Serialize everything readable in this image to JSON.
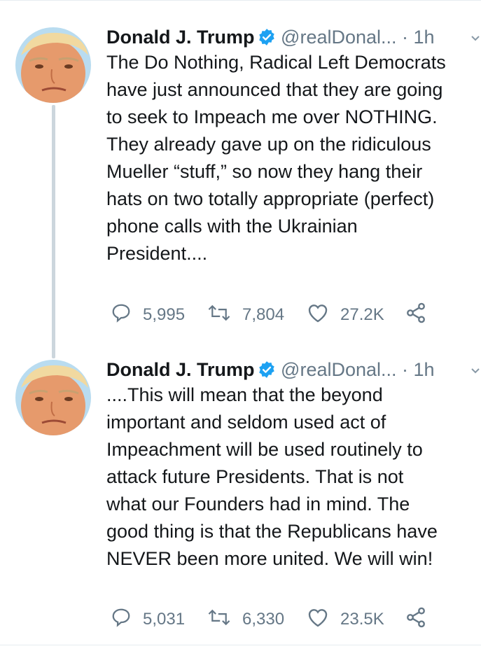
{
  "tweets": [
    {
      "display_name": "Donald J. Trump",
      "handle": "@realDonal...",
      "time": "· 1h",
      "text": "The Do Nothing, Radical Left Democrats\nhave just announced that they are going\nto seek to Impeach me over NOTHING.\nThey already gave up on the ridiculous\nMueller “stuff,” so now they hang their\nhats on two totally appropriate (perfect)\nphone calls with the Ukrainian\nPresident....",
      "replies": "5,995",
      "retweets": "7,804",
      "likes": "27.2K"
    },
    {
      "display_name": "Donald J. Trump",
      "handle": "@realDonal...",
      "time": "· 1h",
      "text": "....This will mean that the beyond\nimportant and seldom used act of\nImpeachment will be used routinely to\nattack future Presidents. That is not\nwhat our Founders had in mind. The\ngood thing is that the Republicans have\nNEVER been more united. We will win!",
      "replies": "5,031",
      "retweets": "6,330",
      "likes": "23.5K"
    }
  ],
  "icons": {
    "reply": "reply-icon",
    "retweet": "retweet-icon",
    "like": "heart-icon",
    "share": "share-icon",
    "verified": "verified-badge-icon",
    "more": "chevron-down-icon"
  },
  "colors": {
    "text": "#14171a",
    "secondary": "#657786",
    "verified": "#1da1f2",
    "thread_line": "#ccd6dd"
  }
}
